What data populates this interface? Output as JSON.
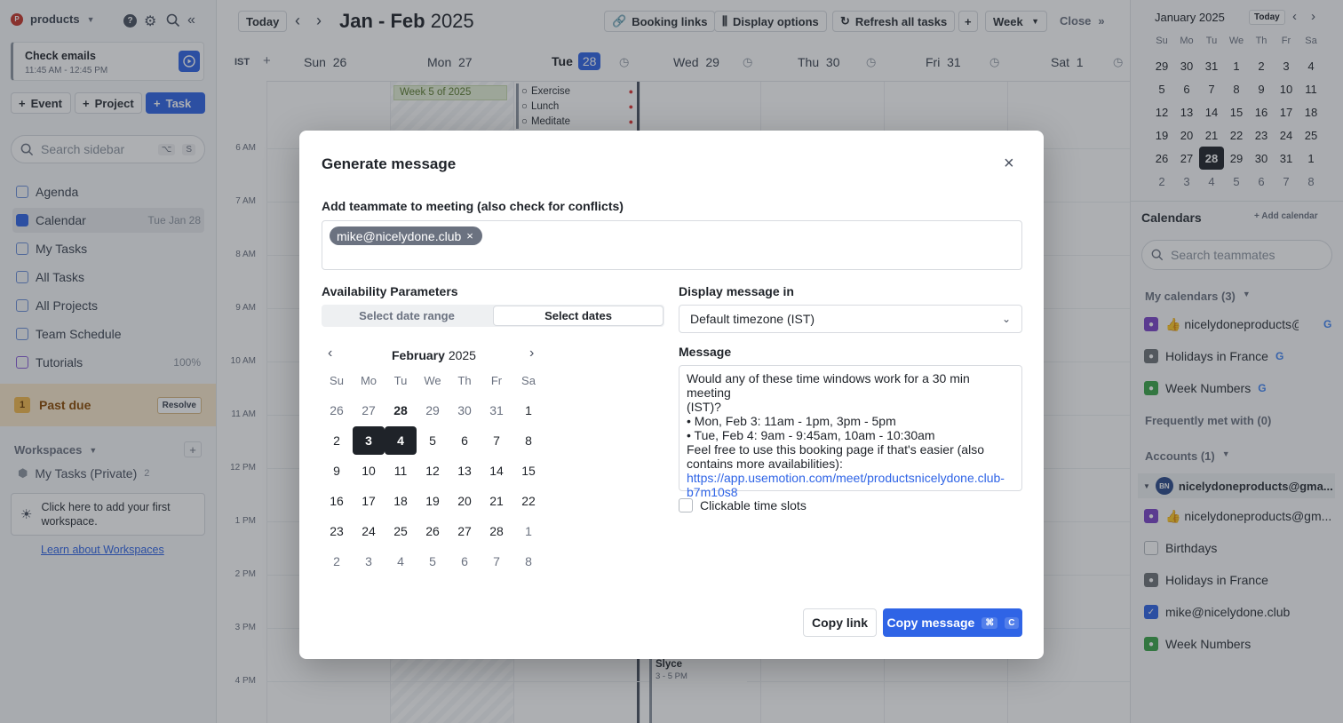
{
  "sidebar": {
    "workspace_initial": "P",
    "workspace_name": "products",
    "current_task": {
      "title": "Check emails",
      "time": "11:45 AM - 12:45 PM"
    },
    "buttons": {
      "event": "Event",
      "project": "Project",
      "task": "Task"
    },
    "search_placeholder": "Search sidebar",
    "search_shortcut_1": "⌥",
    "search_shortcut_2": "S",
    "nav": [
      {
        "label": "Agenda",
        "meta": ""
      },
      {
        "label": "Calendar",
        "meta": "Tue Jan 28"
      },
      {
        "label": "My Tasks",
        "meta": ""
      },
      {
        "label": "All Tasks",
        "meta": ""
      },
      {
        "label": "All Projects",
        "meta": ""
      },
      {
        "label": "Team Schedule",
        "meta": ""
      },
      {
        "label": "Tutorials",
        "meta": "100%"
      }
    ],
    "past_due": {
      "count": "1",
      "label": "Past due",
      "action": "Resolve"
    },
    "workspaces_label": "Workspaces",
    "my_tasks_private": "My Tasks (Private)",
    "my_tasks_private_count": "2",
    "hint_text": "Click here to add your first workspace.",
    "learn_link": "Learn about Workspaces"
  },
  "topbar": {
    "today": "Today",
    "range_bold": "Jan - Feb",
    "range_year": "2025",
    "booking_links": "Booking links",
    "display_options": "Display options",
    "refresh": "Refresh all tasks",
    "view": "Week",
    "close": "Close"
  },
  "calendar": {
    "timezone": "IST",
    "days": [
      {
        "name": "Sun",
        "num": "26"
      },
      {
        "name": "Mon",
        "num": "27"
      },
      {
        "name": "Tue",
        "num": "28"
      },
      {
        "name": "Wed",
        "num": "29"
      },
      {
        "name": "Thu",
        "num": "30"
      },
      {
        "name": "Fri",
        "num": "31"
      },
      {
        "name": "Sat",
        "num": "1"
      }
    ],
    "week_label": "Week 5 of 2025",
    "tasks": [
      "Exercise",
      "Lunch",
      "Meditate"
    ],
    "hours": [
      "6 AM",
      "7 AM",
      "8 AM",
      "9 AM",
      "10 AM",
      "11 AM",
      "12 PM",
      "1 PM",
      "2 PM",
      "3 PM",
      "4 PM"
    ],
    "event_slyce": {
      "title": "Slyce",
      "time": "3 - 5 PM"
    }
  },
  "right_panel": {
    "month": "January",
    "year": "2025",
    "today_btn": "Today",
    "weekdays": [
      "Su",
      "Mo",
      "Tu",
      "We",
      "Th",
      "Fr",
      "Sa"
    ],
    "weeks": [
      [
        "29",
        "30",
        "31",
        "1",
        "2",
        "3",
        "4"
      ],
      [
        "5",
        "6",
        "7",
        "8",
        "9",
        "10",
        "11"
      ],
      [
        "12",
        "13",
        "14",
        "15",
        "16",
        "17",
        "18"
      ],
      [
        "19",
        "20",
        "21",
        "22",
        "23",
        "24",
        "25"
      ],
      [
        "26",
        "27",
        "28",
        "29",
        "30",
        "31",
        "1"
      ],
      [
        "2",
        "3",
        "4",
        "5",
        "6",
        "7",
        "8"
      ]
    ],
    "calendars_label": "Calendars",
    "add_calendar": "Add calendar",
    "search_placeholder": "Search teammates",
    "my_calendars": "My calendars (3)",
    "my_calendar_items": [
      "👍 nicelydoneproducts@...",
      "Holidays in France",
      "Week Numbers"
    ],
    "frequently_met": "Frequently met with (0)",
    "accounts": "Accounts (1)",
    "account_initials": "BN",
    "account_email": "nicelydoneproducts@gma...",
    "account_items": [
      "👍 nicelydoneproducts@gm...",
      "Birthdays",
      "Holidays in France",
      "mike@nicelydone.club",
      "Week Numbers"
    ],
    "colors": {
      "purple": "#7b45c9",
      "gray": "#6f7378",
      "green": "#3aa54a",
      "blue": "#2f64e6"
    }
  },
  "modal": {
    "title": "Generate message",
    "teammate_label": "Add teammate to meeting (also check for conflicts)",
    "teammate_chip": "mike@nicelydone.club",
    "availability_label": "Availability Parameters",
    "seg_range": "Select date range",
    "seg_dates": "Select dates",
    "picker_month": "February",
    "picker_year": "2025",
    "picker_weekdays": [
      "Su",
      "Mo",
      "Tu",
      "We",
      "Th",
      "Fr",
      "Sa"
    ],
    "picker_weeks": [
      [
        "26",
        "27",
        "28",
        "29",
        "30",
        "31",
        "1"
      ],
      [
        "2",
        "3",
        "4",
        "5",
        "6",
        "7",
        "8"
      ],
      [
        "9",
        "10",
        "11",
        "12",
        "13",
        "14",
        "15"
      ],
      [
        "16",
        "17",
        "18",
        "19",
        "20",
        "21",
        "22"
      ],
      [
        "23",
        "24",
        "25",
        "26",
        "27",
        "28",
        "1"
      ],
      [
        "2",
        "3",
        "4",
        "5",
        "6",
        "7",
        "8"
      ]
    ],
    "display_in_label": "Display message in",
    "timezone_value": "Default timezone (IST)",
    "message_label": "Message",
    "message_lines": [
      "Would any of these time windows work for a 30 min meeting",
      "(IST)?",
      "• Mon, Feb 3: 11am - 1pm, 3pm - 5pm",
      "• Tue, Feb 4: 9am - 9:45am, 10am - 10:30am",
      "Feel free to use this booking page if that's easier (also",
      "contains more availabilities):"
    ],
    "message_link_1": "https://app.usemotion.com/meet/productsnicelydone.club-",
    "message_link_2": "b7m10s8",
    "clickable_slots": "Clickable time slots",
    "copy_link": "Copy link",
    "copy_message": "Copy message",
    "shortcut_cmd": "⌘",
    "shortcut_key": "C"
  }
}
